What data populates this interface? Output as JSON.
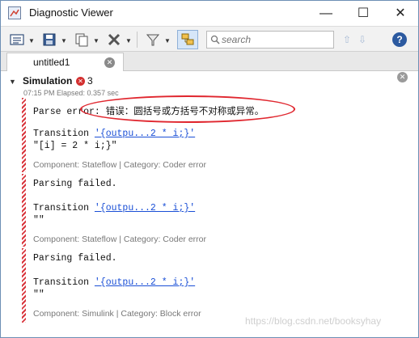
{
  "window": {
    "title": "Diagnostic Viewer",
    "min_glyph": "—",
    "max_glyph": "☐",
    "close_glyph": "✕"
  },
  "toolbar": {
    "search_placeholder": "search",
    "help_label": "?"
  },
  "tab": {
    "label": "untitled1",
    "close_glyph": "✕"
  },
  "simulation": {
    "title": "Simulation",
    "error_count": "3",
    "meta": "07:15 PM   Elapsed: 0.357 sec"
  },
  "entries": [
    {
      "message": "Parse error: 错误：圆括号或方括号不对称或异常。",
      "transition_label": "Transition ",
      "transition_link": "'{outpu...2 * i;}'",
      "code": "\"[i] = 2 * i;}\"",
      "footer": "Component: Stateflow | Category: Coder error"
    },
    {
      "message": "Parsing failed.",
      "transition_label": "Transition ",
      "transition_link": "'{outpu...2 * i;}'",
      "code": "\"\"",
      "footer": "Component: Stateflow | Category: Coder error"
    },
    {
      "message": "Parsing failed.",
      "transition_label": "Transition ",
      "transition_link": "'{outpu...2 * i;}'",
      "code": "\"\"",
      "footer": "Component: Simulink | Category: Block error"
    }
  ],
  "watermark": "https://blog.csdn.net/booksyhay",
  "colors": {
    "error_red": "#d9363e",
    "link_blue": "#1a4fd6",
    "annotation_red": "#e0262e"
  }
}
